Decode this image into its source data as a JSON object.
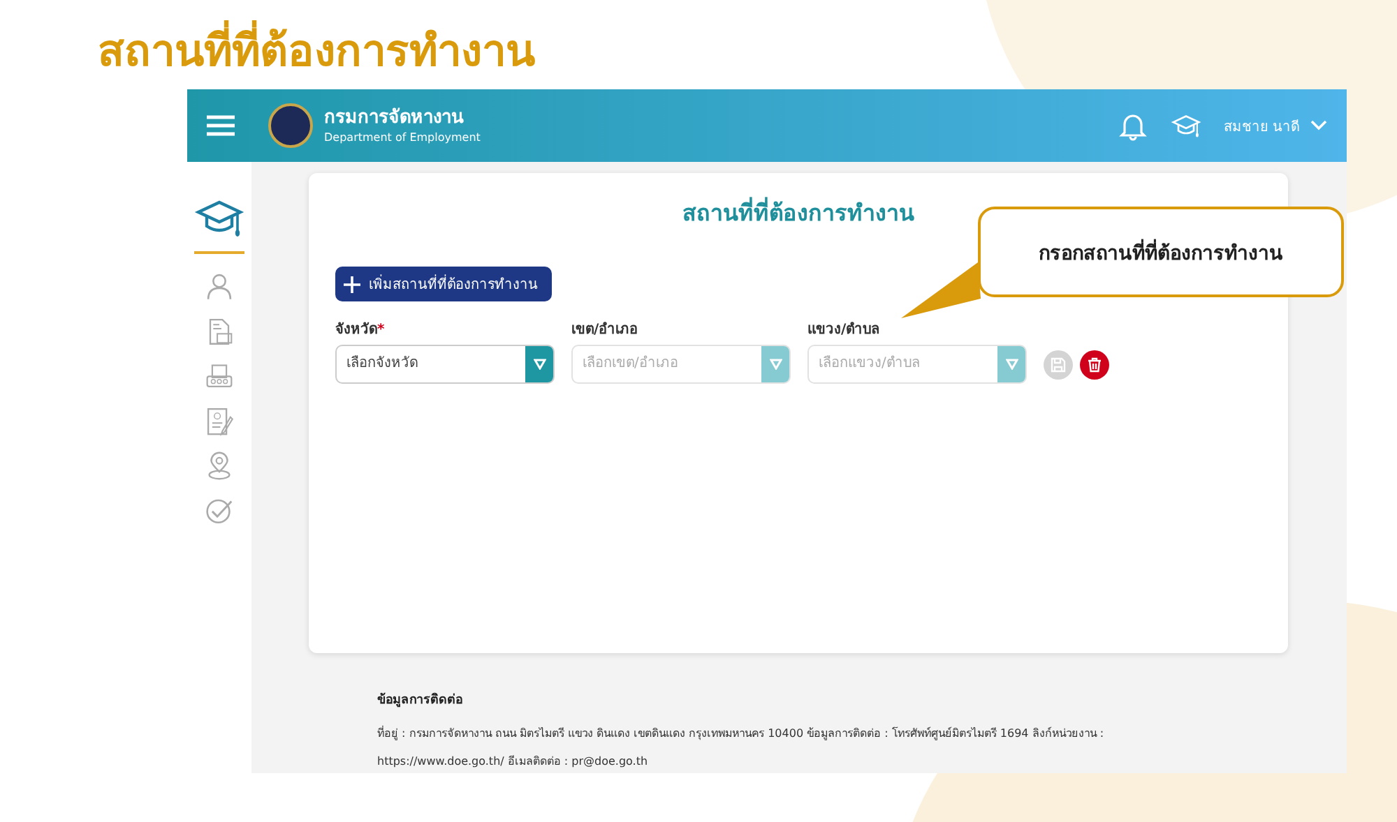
{
  "slide_title": "สถานที่ที่ต้องการทำงาน",
  "header": {
    "title": "กรมการจัดหางาน",
    "subtitle": "Department of Employment",
    "user_name": "สมชาย นาดี"
  },
  "sidebar": {
    "items": [
      {
        "selected": true
      },
      {
        "selected": false
      },
      {
        "selected": false
      },
      {
        "selected": false
      },
      {
        "selected": false
      },
      {
        "selected": false
      },
      {
        "selected": false
      }
    ]
  },
  "card": {
    "title": "สถานที่ที่ต้องการทำงาน",
    "required_mark": "*",
    "add_button": "เพิ่มสถานที่ที่ต้องการทำงาน",
    "fields": [
      {
        "label": "จังหวัด",
        "required": true,
        "placeholder": "เลือกจังหวัด",
        "disabled": false
      },
      {
        "label": "เขต/อำเภอ",
        "required": false,
        "placeholder": "เลือกเขต/อำเภอ",
        "disabled": true
      },
      {
        "label": "แขวง/ตำบล",
        "required": false,
        "placeholder": "เลือกแขวง/ตำบล",
        "disabled": true
      }
    ],
    "actions": [
      {
        "kind": "save",
        "disabled": true
      },
      {
        "kind": "delete",
        "disabled": false
      }
    ]
  },
  "footer": {
    "heading": "ข้อมูลการติดต่อ",
    "text": "ที่อยู่ : กรมการจัดหางาน ถนน มิตรไมตรี แขวง ดินแดง เขตดินแดง กรุงเทพมหานคร 10400 ข้อมูลการติดต่อ : โทรศัพท์ศูนย์มิตรไมตรี 1694 ลิงก์หน่วยงาน : https://www.doe.go.th/ อีเมลติดต่อ : pr@doe.go.th"
  },
  "callout": {
    "text": "กรอกสถานที่ที่ต้องการทำงาน"
  }
}
